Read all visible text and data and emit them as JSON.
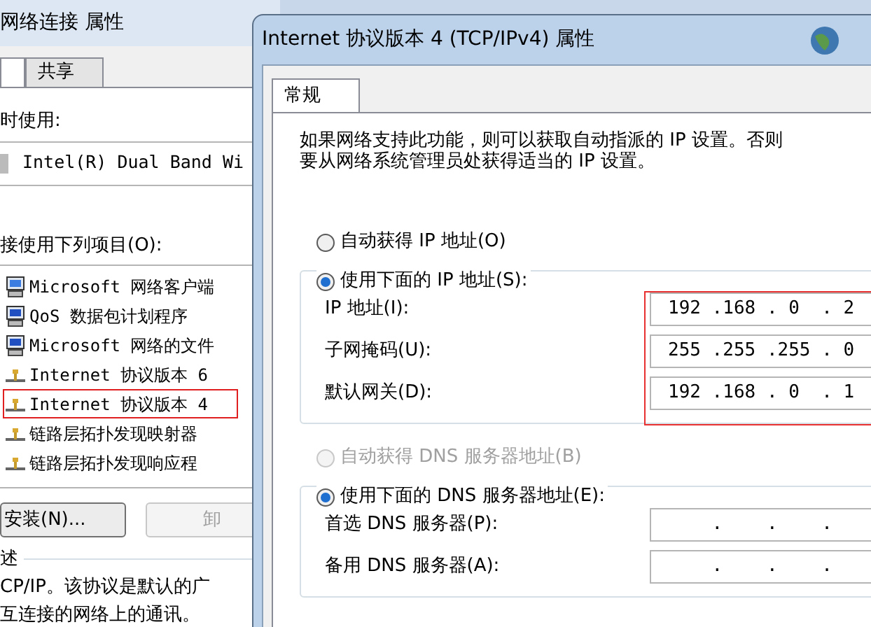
{
  "back_window": {
    "title": "网络连接 属性",
    "tabs": [
      {
        "selected": true
      },
      {
        "label": "共享",
        "selected": false
      }
    ],
    "connect_label": "时使用:",
    "adapter": "Intel(R) Dual Band Wi",
    "items_label": "接使用下列项目(O):",
    "items": [
      {
        "label": "Microsoft 网络客户端",
        "kind": "client",
        "highlighted": false
      },
      {
        "label": "QoS 数据包计划程序",
        "kind": "service",
        "highlighted": false
      },
      {
        "label": "Microsoft 网络的文件",
        "kind": "service",
        "highlighted": false
      },
      {
        "label": "Internet 协议版本 6",
        "kind": "protocol",
        "highlighted": false
      },
      {
        "label": "Internet 协议版本 4",
        "kind": "protocol",
        "highlighted": true
      },
      {
        "label": "链路层拓扑发现映射器",
        "kind": "protocol",
        "highlighted": false
      },
      {
        "label": "链路层拓扑发现响应程",
        "kind": "protocol",
        "highlighted": false
      }
    ],
    "buttons": [
      {
        "label": "安装(N)...",
        "disabled": false
      },
      {
        "label": "卸",
        "disabled": true
      }
    ],
    "description_label": "述",
    "description": [
      "CP/IP。该协议是默认的广",
      "互连接的网络上的通讯。"
    ]
  },
  "dialog": {
    "title": "Internet 协议版本 4 (TCP/IPv4) 属性",
    "tabs": [
      {
        "label": "常规",
        "selected": true
      }
    ],
    "intro": [
      "如果网络支持此功能，则可以获取自动指派的 IP 设置。否则",
      "要从网络系统管理员处获得适当的 IP 设置。"
    ],
    "ip_options": [
      {
        "label": "自动获得 IP 地址(O)",
        "selected": false,
        "disabled": false
      },
      {
        "label": "使用下面的 IP 地址(S):",
        "selected": true,
        "disabled": false
      }
    ],
    "ip_fields": [
      {
        "label": "IP 地址(I):",
        "value": "192 .168 . 0  . 2"
      },
      {
        "label": "子网掩码(U):",
        "value": "255 .255 .255 . 0"
      },
      {
        "label": "默认网关(D):",
        "value": "192 .168 . 0  . 1"
      }
    ],
    "ip_fields_highlighted": true,
    "dns_options": [
      {
        "label": "自动获得 DNS 服务器地址(B)",
        "selected": false,
        "disabled": true
      },
      {
        "label": "使用下面的 DNS 服务器地址(E):",
        "selected": true,
        "disabled": false
      }
    ],
    "dns_fields": [
      {
        "label": "首选 DNS 服务器(P):",
        "value": "    .    .    ."
      },
      {
        "label": "备用 DNS 服务器(A):",
        "value": "    .    .    ."
      }
    ]
  }
}
